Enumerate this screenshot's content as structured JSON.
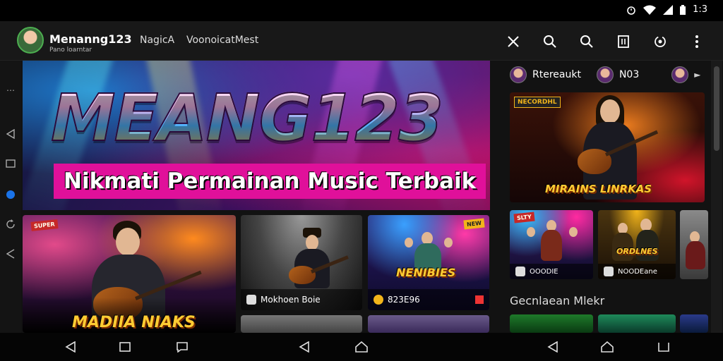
{
  "status_bar": {
    "icons": [
      "alarm-icon",
      "wifi-icon",
      "signal-icon",
      "battery-icon"
    ],
    "time": "1:3"
  },
  "app_bar": {
    "title": "Menanng123",
    "subtitle": "Pano loarntar",
    "tag1": "NagicA",
    "tag2": "VoonoicatMest",
    "actions": [
      "close-icon",
      "search-icon",
      "search-icon",
      "book-icon",
      "sync-icon",
      "more-icon"
    ]
  },
  "rail": {
    "icons": [
      "dots-icon",
      "back-icon",
      "square-icon",
      "dot-icon",
      "refresh-icon",
      "back-icon"
    ],
    "accent": "#1a73e8"
  },
  "hero": {
    "title": "MEANG123",
    "subtitle": "Nikmati Permainan Music Terbaik"
  },
  "cards": {
    "card1": {
      "label": "MADIIA NIAKS",
      "sticker": "SUPER"
    },
    "card2": {
      "caption": "Mokhoen Boie"
    },
    "card3": {
      "caption": "823E96",
      "label": "NENIBIES",
      "sticker": "NEW"
    }
  },
  "right_panel": {
    "header_items": [
      {
        "label": "Rtereaukt"
      },
      {
        "label": "N03"
      },
      {
        "label": ""
      }
    ],
    "feature": {
      "label": "MIRAINS LINRKAS",
      "sticker": "NECORDHL"
    },
    "tiles": [
      {
        "caption": "OOODIE",
        "sticker": "SLTY"
      },
      {
        "caption": "NOODEane",
        "label": "ORDLNES"
      }
    ],
    "section_title": "Gecnlaean Mlekr"
  },
  "nav_bar": {
    "buttons": [
      "back-icon",
      "home-icon",
      "recents-icon"
    ]
  },
  "colors": {
    "hero_banner": "#e0109a",
    "label_gold": "#ffcc33"
  }
}
